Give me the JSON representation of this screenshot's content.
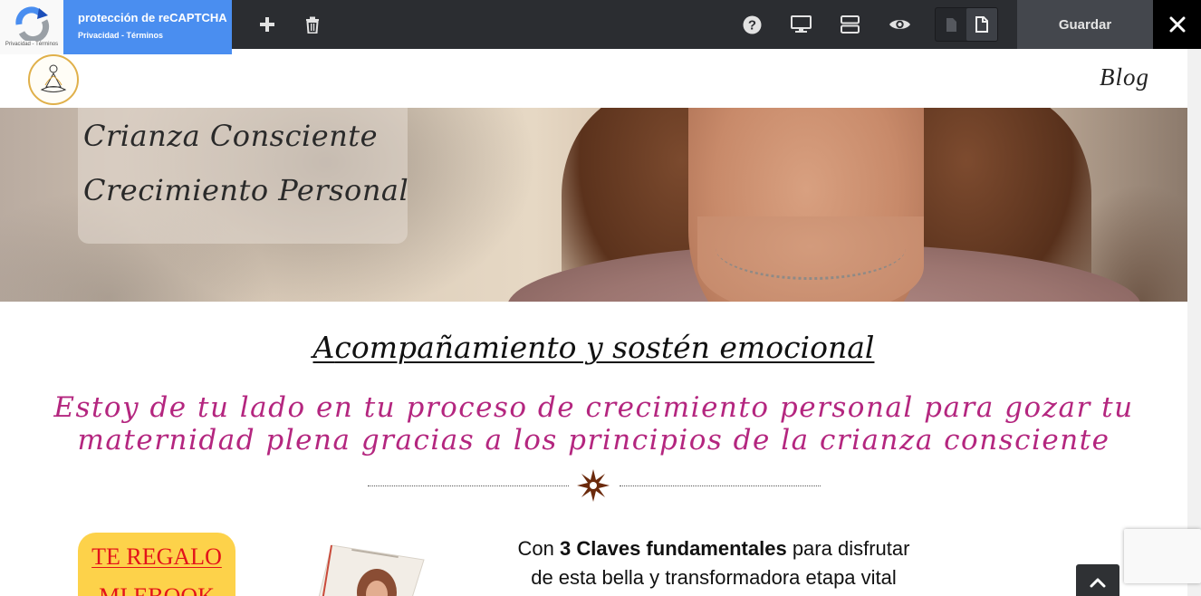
{
  "recaptcha": {
    "title": "protección de reCAPTCHA",
    "links": "Privacidad - Términos",
    "small_links": "Privacidad - Términos"
  },
  "toolbar": {
    "icons": [
      "plus-icon",
      "trash-icon",
      "help-icon",
      "desktop-icon",
      "layout-icon",
      "eye-icon",
      "page-outline-icon",
      "page-filled-icon",
      "close-icon"
    ],
    "save_label": "Guardar"
  },
  "site": {
    "nav": {
      "blog": "Blog"
    }
  },
  "hero": {
    "line1": "Crianza Consciente",
    "line2": "Crecimiento Personal"
  },
  "content": {
    "heading_initial": "A",
    "heading_rest": "compañamiento y sostén emocional",
    "sub_line1": "Estoy de tu lado en tu proceso de crecimiento personal para gozar tu",
    "sub_line2": "maternidad plena gracias a los principios de la crianza consciente",
    "gift_line1": "TE REGALO",
    "gift_line2": "MI EBOOK",
    "claves_pre": "Con ",
    "claves_bold": "3 Claves fundamentales",
    "claves_post": " para disfrutar",
    "claves_line2": "de esta bella y transformadora etapa vital"
  },
  "colors": {
    "toolbar_bg": "#2b2d31",
    "recaptcha_blue": "#4a8ef0",
    "accent_magenta": "#b4267f",
    "gift_yellow": "#fdd24a",
    "gift_red": "#e3131a",
    "divider_star": "#6b2a0c"
  }
}
